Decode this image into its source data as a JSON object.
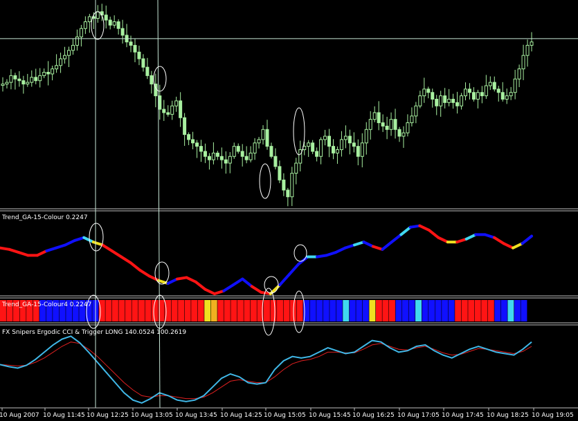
{
  "colors": {
    "background": "#000000",
    "separator": "#c0c0c0",
    "candle": "#a8f0a0",
    "crosshair": "#c8e8d8",
    "trend_up": "#1010ff",
    "trend_down": "#ff1414",
    "trend_cyan": "#40d8f0",
    "trend_yellow": "#f0e020",
    "histo_orange": "#f0b020",
    "ergodic_main": "#40b8e8",
    "ergodic_signal": "#e02020",
    "marker_ellipse": "#ffffff",
    "axis_text": "#ffffff"
  },
  "panels": {
    "price": {
      "label": ""
    },
    "trend": {
      "label": "Trend_GA-15-Colour 0.2247"
    },
    "trend_histogram": {
      "label": "Trend_GA-15-Colour4 0.2247"
    },
    "ergodic": {
      "label": "FX Snipers Ergodic CCI & Trigger LONG 140.0524 100.2619"
    }
  },
  "time_axis": {
    "labels": [
      "10 Aug 2007",
      "10 Aug 11:45",
      "10 Aug 12:25",
      "10 Aug 13:05",
      "10 Aug 13:45",
      "10 Aug 14:25",
      "10 Aug 15:05",
      "10 Aug 15:45",
      "10 Aug 16:25",
      "10 Aug 17:05",
      "10 Aug 17:45",
      "10 Aug 18:25",
      "10 Aug 19:05"
    ]
  },
  "chart_data": [
    {
      "type": "candlestick",
      "title": "",
      "y_profile": [
        0.55,
        0.56,
        0.6,
        0.58,
        0.57,
        0.55,
        0.56,
        0.59,
        0.57,
        0.6,
        0.62,
        0.61,
        0.64,
        0.66,
        0.7,
        0.72,
        0.75,
        0.78,
        0.83,
        0.88,
        0.92,
        0.95,
        0.94,
        0.98,
        0.96,
        0.93,
        0.9,
        0.92,
        0.88,
        0.84,
        0.8,
        0.78,
        0.74,
        0.7,
        0.65,
        0.6,
        0.55,
        0.48,
        0.4,
        0.38,
        0.37,
        0.42,
        0.45,
        0.35,
        0.25,
        0.22,
        0.2,
        0.18,
        0.15,
        0.12,
        0.1,
        0.14,
        0.12,
        0.1,
        0.08,
        0.12,
        0.18,
        0.15,
        0.12,
        0.1,
        0.14,
        0.2,
        0.22,
        0.28,
        0.18,
        0.12,
        0.06,
        -0.02,
        -0.08,
        -0.12,
        0.02,
        0.08,
        0.16,
        0.18,
        0.2,
        0.15,
        0.12,
        0.22,
        0.24,
        0.18,
        0.14,
        0.16,
        0.22,
        0.24,
        0.2,
        0.18,
        0.12,
        0.2,
        0.28,
        0.34,
        0.38,
        0.32,
        0.3,
        0.28,
        0.34,
        0.28,
        0.24,
        0.26,
        0.32,
        0.36,
        0.42,
        0.48,
        0.52,
        0.5,
        0.46,
        0.42,
        0.48,
        0.44,
        0.46,
        0.44,
        0.42,
        0.48,
        0.52,
        0.5,
        0.46,
        0.5,
        0.48,
        0.54,
        0.56,
        0.52,
        0.5,
        0.46,
        0.48,
        0.5,
        0.58,
        0.64,
        0.72,
        0.78,
        0.8
      ],
      "crosshair_level": 0.82
    },
    {
      "type": "line",
      "title": "Trend_GA-15-Colour 0.2247",
      "points": [
        0.62,
        0.6,
        0.56,
        0.52,
        0.52,
        0.58,
        0.62,
        0.66,
        0.72,
        0.76,
        0.7,
        0.66,
        0.58,
        0.5,
        0.42,
        0.32,
        0.24,
        0.18,
        0.14,
        0.2,
        0.22,
        0.16,
        0.06,
        0.0,
        0.04,
        0.12,
        0.2,
        0.1,
        0.02,
        0.0,
        0.12,
        0.26,
        0.4,
        0.5,
        0.5,
        0.52,
        0.56,
        0.62,
        0.66,
        0.7,
        0.64,
        0.6,
        0.7,
        0.8,
        0.9,
        0.92,
        0.86,
        0.76,
        0.7,
        0.7,
        0.74,
        0.8,
        0.8,
        0.76,
        0.68,
        0.62,
        0.68,
        0.78
      ],
      "series_colors": [
        "down",
        "down",
        "down",
        "down",
        "down",
        "up",
        "up",
        "up",
        "up",
        "cyan",
        "yellow",
        "down",
        "down",
        "down",
        "down",
        "down",
        "down",
        "yellow",
        "up",
        "down",
        "down",
        "down",
        "down",
        "down",
        "up",
        "up",
        "up",
        "down",
        "down",
        "yellow",
        "up",
        "up",
        "up",
        "cyan",
        "up",
        "up",
        "up",
        "up",
        "cyan",
        "up",
        "down",
        "up",
        "up",
        "cyan",
        "up",
        "down",
        "down",
        "down",
        "yellow",
        "down",
        "cyan",
        "up",
        "up",
        "down",
        "down",
        "yellow",
        "up",
        "up"
      ]
    },
    {
      "type": "bar",
      "title": "Trend_GA-15-Colour4 0.2247",
      "categories_count": 80,
      "bar_colors": [
        "red",
        "red",
        "red",
        "red",
        "red",
        "red",
        "blue",
        "blue",
        "blue",
        "blue",
        "blue",
        "blue",
        "blue",
        "blue",
        "blue",
        "red",
        "red",
        "red",
        "red",
        "red",
        "red",
        "red",
        "red",
        "red",
        "red",
        "red",
        "red",
        "red",
        "red",
        "red",
        "red",
        "yellow",
        "orange",
        "red",
        "red",
        "red",
        "red",
        "red",
        "red",
        "red",
        "red",
        "red",
        "red",
        "red",
        "red",
        "red",
        "blue",
        "blue",
        "blue",
        "blue",
        "blue",
        "blue",
        "cyan",
        "blue",
        "blue",
        "blue",
        "yellow",
        "red",
        "red",
        "red",
        "blue",
        "blue",
        "blue",
        "cyan",
        "blue",
        "blue",
        "blue",
        "blue",
        "blue",
        "red",
        "red",
        "red",
        "red",
        "red",
        "red",
        "blue",
        "blue",
        "cyan",
        "blue",
        "blue"
      ]
    },
    {
      "type": "line",
      "title": "FX Snipers Ergodic CCI & Trigger LONG 140.0524 100.2619",
      "series": [
        {
          "name": "Ergodic",
          "values": [
            0.55,
            0.52,
            0.5,
            0.54,
            0.62,
            0.72,
            0.82,
            0.9,
            0.94,
            0.85,
            0.72,
            0.58,
            0.44,
            0.3,
            0.16,
            0.06,
            0.02,
            0.08,
            0.16,
            0.12,
            0.06,
            0.04,
            0.06,
            0.12,
            0.24,
            0.36,
            0.42,
            0.38,
            0.3,
            0.28,
            0.3,
            0.48,
            0.6,
            0.66,
            0.64,
            0.66,
            0.72,
            0.78,
            0.74,
            0.7,
            0.72,
            0.8,
            0.88,
            0.86,
            0.78,
            0.72,
            0.74,
            0.8,
            0.82,
            0.74,
            0.68,
            0.64,
            0.7,
            0.76,
            0.8,
            0.76,
            0.72,
            0.7,
            0.68,
            0.76,
            0.86
          ]
        },
        {
          "name": "Trigger",
          "values": [
            0.55,
            0.54,
            0.53,
            0.54,
            0.58,
            0.64,
            0.72,
            0.8,
            0.86,
            0.84,
            0.76,
            0.66,
            0.54,
            0.42,
            0.3,
            0.2,
            0.12,
            0.1,
            0.12,
            0.12,
            0.1,
            0.08,
            0.08,
            0.1,
            0.16,
            0.24,
            0.32,
            0.34,
            0.32,
            0.3,
            0.3,
            0.38,
            0.48,
            0.56,
            0.6,
            0.62,
            0.66,
            0.72,
            0.72,
            0.71,
            0.71,
            0.76,
            0.82,
            0.84,
            0.8,
            0.76,
            0.75,
            0.78,
            0.8,
            0.76,
            0.71,
            0.68,
            0.69,
            0.73,
            0.77,
            0.76,
            0.74,
            0.72,
            0.7,
            0.73,
            0.8
          ]
        }
      ]
    }
  ]
}
